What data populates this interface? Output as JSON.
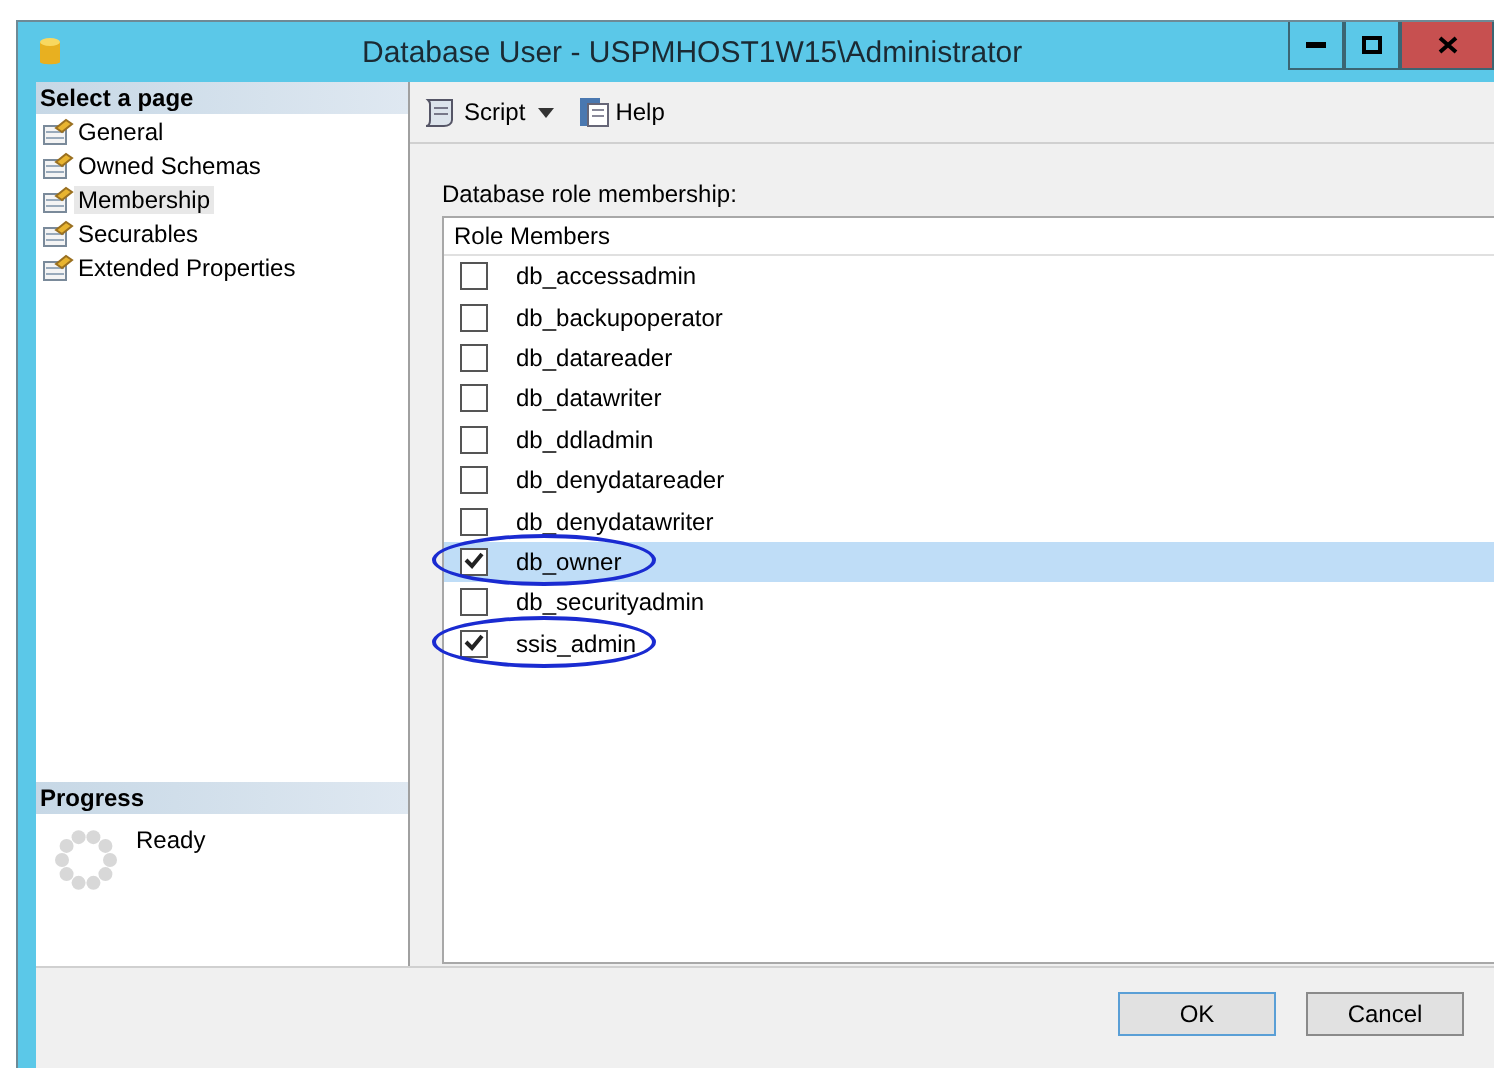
{
  "window": {
    "title": "Database User - USPMHOST1W15\\Administrator"
  },
  "sidebar": {
    "heading": "Select a page",
    "items": [
      {
        "label": "General",
        "selected": false
      },
      {
        "label": "Owned Schemas",
        "selected": false
      },
      {
        "label": "Membership",
        "selected": true
      },
      {
        "label": "Securables",
        "selected": false
      },
      {
        "label": "Extended Properties",
        "selected": false
      }
    ]
  },
  "progress": {
    "heading": "Progress",
    "status": "Ready"
  },
  "toolbar": {
    "script": "Script",
    "help": "Help"
  },
  "roles": {
    "label": "Database role membership:",
    "column": "Role Members",
    "rows": [
      {
        "name": "db_accessadmin",
        "checked": false,
        "selected": false,
        "circled": false
      },
      {
        "name": "db_backupoperator",
        "checked": false,
        "selected": false,
        "circled": false
      },
      {
        "name": "db_datareader",
        "checked": false,
        "selected": false,
        "circled": false
      },
      {
        "name": "db_datawriter",
        "checked": false,
        "selected": false,
        "circled": false
      },
      {
        "name": "db_ddladmin",
        "checked": false,
        "selected": false,
        "circled": false
      },
      {
        "name": "db_denydatareader",
        "checked": false,
        "selected": false,
        "circled": false
      },
      {
        "name": "db_denydatawriter",
        "checked": false,
        "selected": false,
        "circled": false
      },
      {
        "name": "db_owner",
        "checked": true,
        "selected": true,
        "circled": true
      },
      {
        "name": "db_securityadmin",
        "checked": false,
        "selected": false,
        "circled": false
      },
      {
        "name": "ssis_admin",
        "checked": true,
        "selected": false,
        "circled": true
      }
    ]
  },
  "buttons": [
    "OK",
    "Cancel"
  ]
}
